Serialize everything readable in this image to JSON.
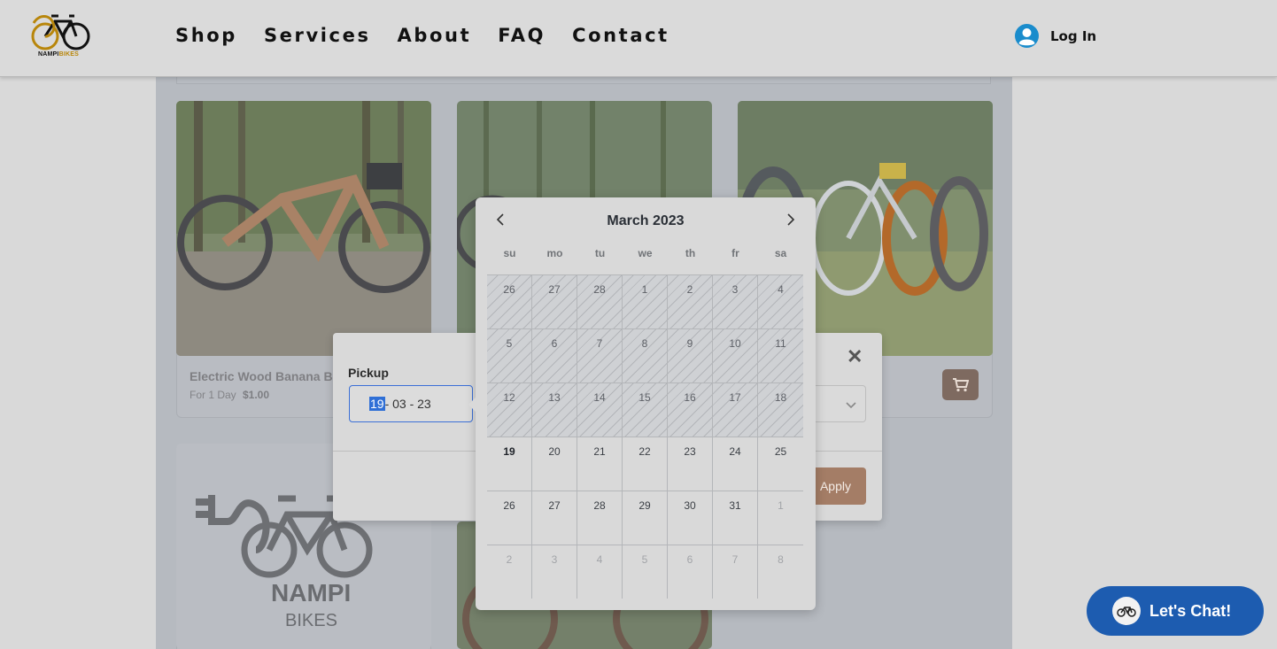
{
  "brand": {
    "logo_text_a": "NAMPI",
    "logo_text_b": "BIKES"
  },
  "nav": [
    {
      "label": "Shop"
    },
    {
      "label": "Services"
    },
    {
      "label": "About"
    },
    {
      "label": "FAQ"
    },
    {
      "label": "Contact"
    }
  ],
  "login": {
    "label": "Log In",
    "icon": "user-circle-icon"
  },
  "product_card": {
    "title": "Electric Wood Banana Bi",
    "price_label": "For 1 Day",
    "price": "$1.00",
    "cart_icon": "cart-icon"
  },
  "promo_logo": {
    "line1": "NAMPI",
    "line2": "BIKES"
  },
  "modal": {
    "pickup_label": "Pickup",
    "pickup_day_selected": "19",
    "pickup_rest": "- 03 - 23",
    "close_icon": "close-icon",
    "apply_label": "Apply"
  },
  "calendar": {
    "title": "March 2023",
    "weekdays": [
      "su",
      "mo",
      "tu",
      "we",
      "th",
      "fr",
      "sa"
    ],
    "weeks": [
      [
        "26",
        "27",
        "28",
        "1",
        "2",
        "3",
        "4"
      ],
      [
        "5",
        "6",
        "7",
        "8",
        "9",
        "10",
        "11"
      ],
      [
        "12",
        "13",
        "14",
        "15",
        "16",
        "17",
        "18"
      ],
      [
        "19",
        "20",
        "21",
        "22",
        "23",
        "24",
        "25"
      ],
      [
        "26",
        "27",
        "28",
        "29",
        "30",
        "31",
        "1"
      ],
      [
        "2",
        "3",
        "4",
        "5",
        "6",
        "7",
        "8"
      ]
    ],
    "today": "19"
  },
  "chat": {
    "label": "Let's Chat!"
  },
  "colors": {
    "accent_brown": "#a47d66",
    "chat_blue": "#1d5cb0",
    "login_icon_blue": "#1a8ccc",
    "logo_gold": "#b8860b"
  }
}
